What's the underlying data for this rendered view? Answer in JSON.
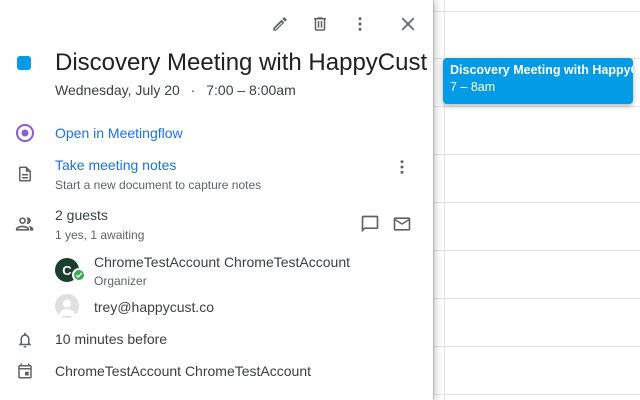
{
  "toolbar": {
    "edit_icon": "pencil-icon",
    "delete_icon": "trash-icon",
    "more_icon": "more-vert-icon",
    "close_icon": "close-icon"
  },
  "event": {
    "title": "Discovery Meeting with HappyCust",
    "date": "Wednesday, July 20",
    "separator": "·",
    "time": "7:00 – 8:00am",
    "color": "#039be5"
  },
  "meetingflow": {
    "label": "Open in Meetingflow"
  },
  "notes": {
    "label": "Take meeting notes",
    "description": "Start a new document to capture notes"
  },
  "guests": {
    "count_label": "2 guests",
    "rsvp_summary": "1 yes, 1 awaiting",
    "list": [
      {
        "initial": "C",
        "name": "ChromeTestAccount ChromeTestAccount",
        "role": "Organizer"
      },
      {
        "initial": "",
        "name": "trey@happycust.co",
        "role": ""
      }
    ]
  },
  "reminder": {
    "label": "10 minutes before"
  },
  "calendar_owner": {
    "label": "ChromeTestAccount ChromeTestAccount"
  },
  "chip": {
    "title": "Discovery Meeting with HappyCust",
    "time": "7 – 8am"
  }
}
